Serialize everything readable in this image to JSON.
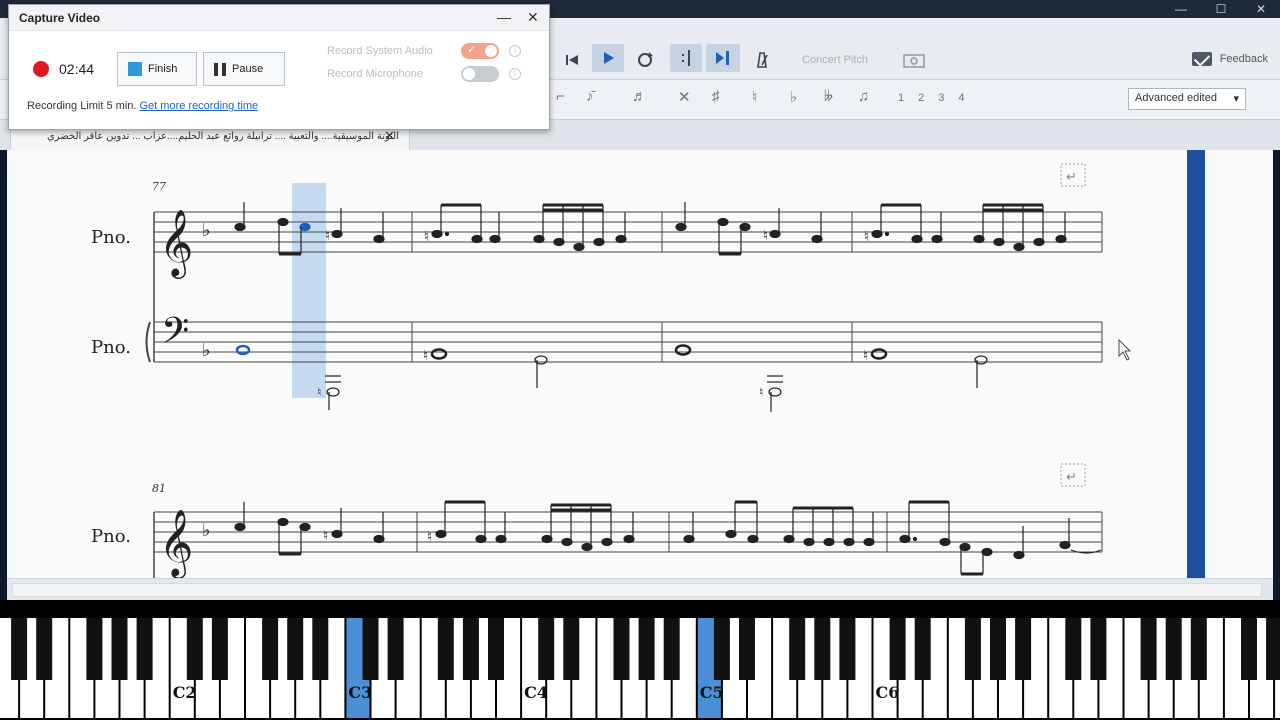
{
  "capture": {
    "title": "Capture Video",
    "minimize_glyph": "—",
    "close_glyph": "✕",
    "elapsed": "02:44",
    "finish_label": "Finish",
    "pause_label": "Pause",
    "record_system_audio_label": "Record System Audio",
    "record_system_audio_on": true,
    "record_microphone_label": "Record Microphone",
    "record_microphone_on": false,
    "limit_text": "Recording Limit 5 min.",
    "limit_link": "Get more recording time",
    "recording_color": "#e0181f"
  },
  "toolbar": {
    "concert_pitch_label": "Concert Pitch",
    "feedback_label": "Feedback",
    "workspace_value": "Advanced edited",
    "voice_numbers": [
      "1",
      "2",
      "3",
      "4"
    ],
    "accent_color": "#1f5fb4"
  },
  "tab": {
    "title": "النوتة الموسيقية.... والتعبية .... ترانيلة روائع عبد الحليم....عزاب ... تدوين عاقر الخضري",
    "close_glyph": "✕"
  },
  "score": {
    "systems": [
      {
        "measure_number": "77",
        "staff_labels": [
          "Pno.",
          "Pno."
        ]
      },
      {
        "measure_number": "81",
        "staff_labels": [
          "Pno."
        ]
      }
    ],
    "selection_color": "#bcd4ec",
    "playhead_color": "#1e4f9a"
  },
  "piano": {
    "octave_labels": [
      "C2",
      "C3",
      "C4",
      "C5",
      "C6"
    ],
    "highlighted_keys": [
      "C3",
      "C5"
    ],
    "highlight_color": "#4b8fd6"
  }
}
